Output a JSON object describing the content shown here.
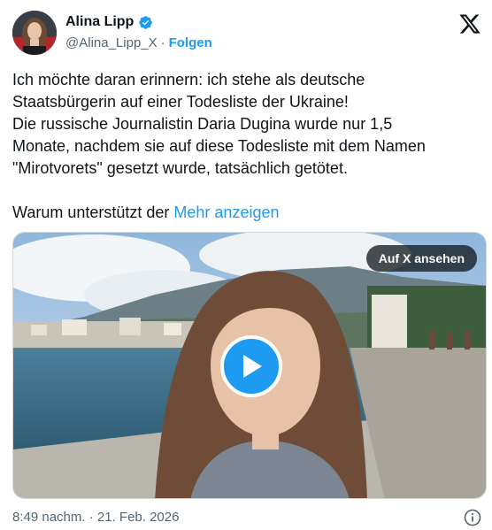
{
  "author": {
    "display_name": "Alina Lipp",
    "handle": "@Alina_Lipp_X",
    "separator": "·",
    "follow_label": "Folgen",
    "avatar_icon": "profile-photo",
    "verified_icon": "verified-badge-icon"
  },
  "brand": {
    "logo_icon": "x-logo-icon"
  },
  "tweet": {
    "lines": [
      "Ich möchte daran erinnern: ich stehe als deutsche",
      "Staatsbürgerin auf einer Todesliste der Ukraine!",
      "Die russische Journalistin Daria Dugina wurde nur 1,5",
      "Monate, nachdem sie auf diese Todesliste mit dem Namen",
      "\"Mirotvorets\" gesetzt wurde, tatsächlich getötet."
    ],
    "truncated_text": "Warum unterstützt der",
    "more_label": "Mehr anzeigen"
  },
  "media": {
    "watch_label": "Auf X ansehen",
    "play_icon": "play-icon"
  },
  "footer": {
    "timestamp": "8:49 nachm. · 21. Feb. 2026",
    "info_icon": "info-icon"
  },
  "colors": {
    "accent": "#1d9bf0",
    "text": "#0f1419",
    "muted": "#536471"
  }
}
